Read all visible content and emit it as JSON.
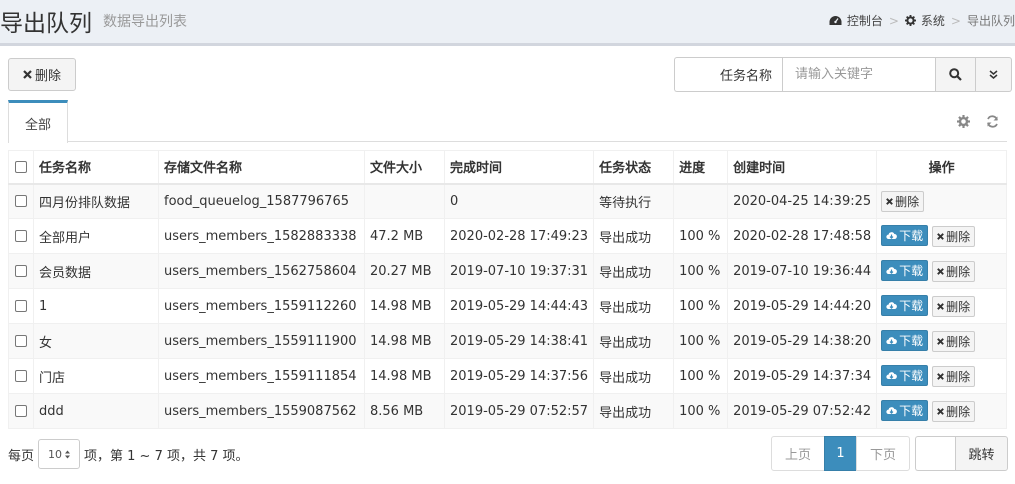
{
  "header": {
    "title": "导出队列",
    "subtitle": "数据导出列表",
    "breadcrumb": [
      "控制台",
      "系统",
      "导出队列"
    ]
  },
  "toolbar": {
    "delete_label": "删除",
    "search_label": "任务名称",
    "search_placeholder": "请输入关键字"
  },
  "tabs": [
    {
      "label": "全部"
    }
  ],
  "table": {
    "columns": [
      "任务名称",
      "存储文件名称",
      "文件大小",
      "完成时间",
      "任务状态",
      "进度",
      "创建时间",
      "操作"
    ],
    "download_label": "下载",
    "delete_label": "删除",
    "rows": [
      {
        "name": "四月份排队数据",
        "file": "food_queuelog_1587796765",
        "size": "",
        "finished": "0",
        "status": "等待执行",
        "progress": "",
        "created": "2020-04-25 14:39:25",
        "download": false
      },
      {
        "name": "全部用户",
        "file": "users_members_1582883338",
        "size": "47.2 MB",
        "finished": "2020-02-28 17:49:23",
        "status": "导出成功",
        "progress": "100 %",
        "created": "2020-02-28 17:48:58",
        "download": true
      },
      {
        "name": "会员数据",
        "file": "users_members_1562758604",
        "size": "20.27 MB",
        "finished": "2019-07-10 19:37:31",
        "status": "导出成功",
        "progress": "100 %",
        "created": "2019-07-10 19:36:44",
        "download": true
      },
      {
        "name": "1",
        "file": "users_members_1559112260",
        "size": "14.98 MB",
        "finished": "2019-05-29 14:44:43",
        "status": "导出成功",
        "progress": "100 %",
        "created": "2019-05-29 14:44:20",
        "download": true
      },
      {
        "name": "女",
        "file": "users_members_1559111900",
        "size": "14.98 MB",
        "finished": "2019-05-29 14:38:41",
        "status": "导出成功",
        "progress": "100 %",
        "created": "2019-05-29 14:38:20",
        "download": true
      },
      {
        "name": "门店",
        "file": "users_members_1559111854",
        "size": "14.98 MB",
        "finished": "2019-05-29 14:37:56",
        "status": "导出成功",
        "progress": "100 %",
        "created": "2019-05-29 14:37:34",
        "download": true
      },
      {
        "name": "ddd",
        "file": "users_members_1559087562",
        "size": "8.56 MB",
        "finished": "2019-05-29 07:52:57",
        "status": "导出成功",
        "progress": "100 %",
        "created": "2019-05-29 07:52:42",
        "download": true
      }
    ]
  },
  "footer": {
    "per_page_prefix": "每页",
    "page_size": "10",
    "per_page_suffix": "项，第 1 ~ 7 项，共 7 项。",
    "prev": "上页",
    "current_page": "1",
    "next": "下页",
    "jump_label": "跳转"
  },
  "colors": {
    "primary": "#3c8dbc",
    "header_bg": "#ecf0f5"
  }
}
